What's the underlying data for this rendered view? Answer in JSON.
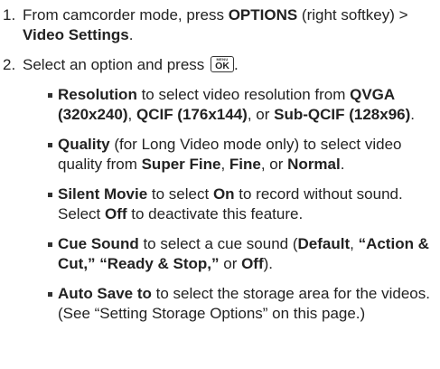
{
  "steps": [
    {
      "num": "1.",
      "t1": "From camcorder mode, press ",
      "b1": "OPTIONS",
      "t2": " (right softkey) > ",
      "b2": "Video Settings",
      "t3": "."
    },
    {
      "num": "2.",
      "t1": "Select an option and press ",
      "key_top": "MENU",
      "key_bottom": "OK",
      "t2": "."
    }
  ],
  "options": [
    {
      "segments": [
        {
          "text": "Resolution",
          "bold": true
        },
        {
          "text": " to select video resolution from ",
          "bold": false
        },
        {
          "text": "QVGA (320x240)",
          "bold": true
        },
        {
          "text": ", ",
          "bold": false
        },
        {
          "text": "QCIF (176x144)",
          "bold": true
        },
        {
          "text": ", or ",
          "bold": false
        },
        {
          "text": "Sub-QCIF (128x96)",
          "bold": true
        },
        {
          "text": ".",
          "bold": false
        }
      ]
    },
    {
      "segments": [
        {
          "text": "Quality",
          "bold": true
        },
        {
          "text": " (for Long Video mode only) to select video quality from ",
          "bold": false
        },
        {
          "text": "Super Fine",
          "bold": true
        },
        {
          "text": ", ",
          "bold": false
        },
        {
          "text": "Fine",
          "bold": true
        },
        {
          "text": ", or ",
          "bold": false
        },
        {
          "text": "Normal",
          "bold": true
        },
        {
          "text": ".",
          "bold": false
        }
      ]
    },
    {
      "segments": [
        {
          "text": "Silent Movie",
          "bold": true
        },
        {
          "text": " to select ",
          "bold": false
        },
        {
          "text": "On",
          "bold": true
        },
        {
          "text": " to record without sound. Select ",
          "bold": false
        },
        {
          "text": "Off",
          "bold": true
        },
        {
          "text": " to deactivate this feature.",
          "bold": false
        }
      ]
    },
    {
      "segments": [
        {
          "text": "Cue Sound",
          "bold": true
        },
        {
          "text": " to select a cue sound (",
          "bold": false
        },
        {
          "text": "Default",
          "bold": true
        },
        {
          "text": ", ",
          "bold": false
        },
        {
          "text": "“Action & Cut,” “Ready & Stop,”",
          "bold": true
        },
        {
          "text": " or ",
          "bold": false
        },
        {
          "text": "Off",
          "bold": true
        },
        {
          "text": ").",
          "bold": false
        }
      ]
    },
    {
      "segments": [
        {
          "text": "Auto Save to",
          "bold": true
        },
        {
          "text": " to select the storage area for the videos. (See “Setting Storage Options” on this page.)",
          "bold": false
        }
      ]
    }
  ]
}
